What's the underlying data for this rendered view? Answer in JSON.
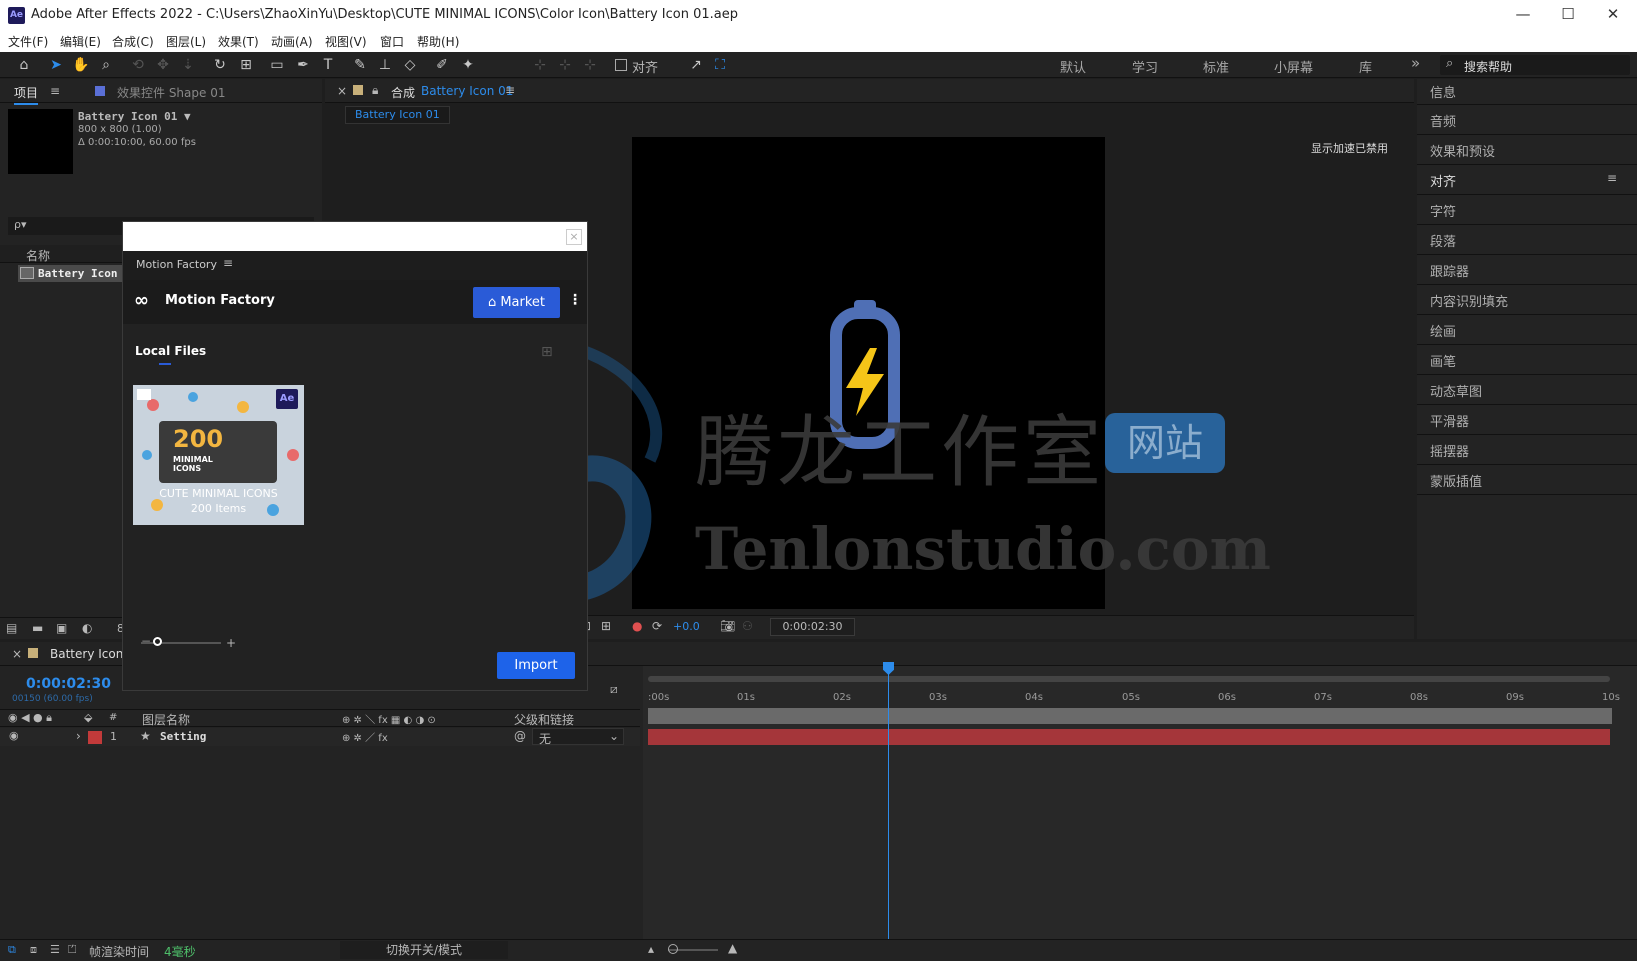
{
  "window": {
    "app_badge": "Ae",
    "title": "Adobe After Effects 2022 - C:\\Users\\ZhaoXinYu\\Desktop\\CUTE MINIMAL ICONS\\Color Icon\\Battery Icon 01.aep",
    "min": "—",
    "max": "☐",
    "close": "✕"
  },
  "menu": [
    "文件(F)",
    "编辑(E)",
    "合成(C)",
    "图层(L)",
    "效果(T)",
    "动画(A)",
    "视图(V)",
    "窗口",
    "帮助(H)"
  ],
  "toolbar": {
    "snap_label": "对齐",
    "workspaces": [
      "默认",
      "学习",
      "标准",
      "小屏幕",
      "库"
    ],
    "overflow": "»",
    "search_placeholder": "搜索帮助"
  },
  "project": {
    "tab_project": "项目",
    "tab_effects": "效果控件 Shape 01",
    "comp_name": "Battery Icon 01 ▼",
    "comp_size": "800 x 800 (1.00)",
    "comp_duration": "Δ 0:00:10:00, 60.00 fps",
    "search_icon": "ρ▾",
    "col_name": "名称",
    "item_name": "Battery Icon",
    "bpc": "8"
  },
  "comp": {
    "tab_prefix": "合成",
    "tab_name": "Battery Icon 01",
    "breadcrumb": "Battery Icon 01",
    "accel_notice": "显示加速已禁用",
    "exposure": "+0.0",
    "timecode": "0:00:02:30"
  },
  "right_panel": [
    "信息",
    "音频",
    "效果和预设",
    "对齐",
    "字符",
    "段落",
    "跟踪器",
    "内容识别填充",
    "绘画",
    "画笔",
    "动态草图",
    "平滑器",
    "摇摆器",
    "蒙版插值"
  ],
  "motion_factory": {
    "panel_title": "Motion Factory",
    "brand": "Motion Factory",
    "market": "Market",
    "local_files": "Local Files",
    "pack_title_num": "200",
    "pack_title_text": "MINIMAL\nICONS",
    "pack_name": "CUTE MINIMAL ICONS",
    "pack_count": "200 Items",
    "import": "Import",
    "badge": "Ae"
  },
  "timeline": {
    "tab_name": "Battery Icon 01",
    "timecode": "0:00:02:30",
    "frame_info": "00150 (60.00 fps)",
    "col_num": "#",
    "col_layer": "图层名称",
    "col_parent": "父级和链接",
    "layer_num": "1",
    "layer_name": "Setting",
    "parent_value": "无",
    "ruler": [
      ":00s",
      "01s",
      "02s",
      "03s",
      "04s",
      "05s",
      "06s",
      "07s",
      "08s",
      "09s",
      "10s"
    ]
  },
  "status": {
    "render_label": "帧渲染时间",
    "render_value": "4毫秒",
    "toggle": "切换开关/模式"
  },
  "watermark": {
    "cn": "腾龙工作室",
    "tag": "网站",
    "en": "Tenlonstudio.com"
  },
  "colors": {
    "accent": "#2d8ceb",
    "layer_bar": "#a5363a",
    "label_red": "#c23a3a",
    "battery_body": "#4f6fb5",
    "bolt": "#f5c518",
    "market": "#2a5bd7"
  }
}
